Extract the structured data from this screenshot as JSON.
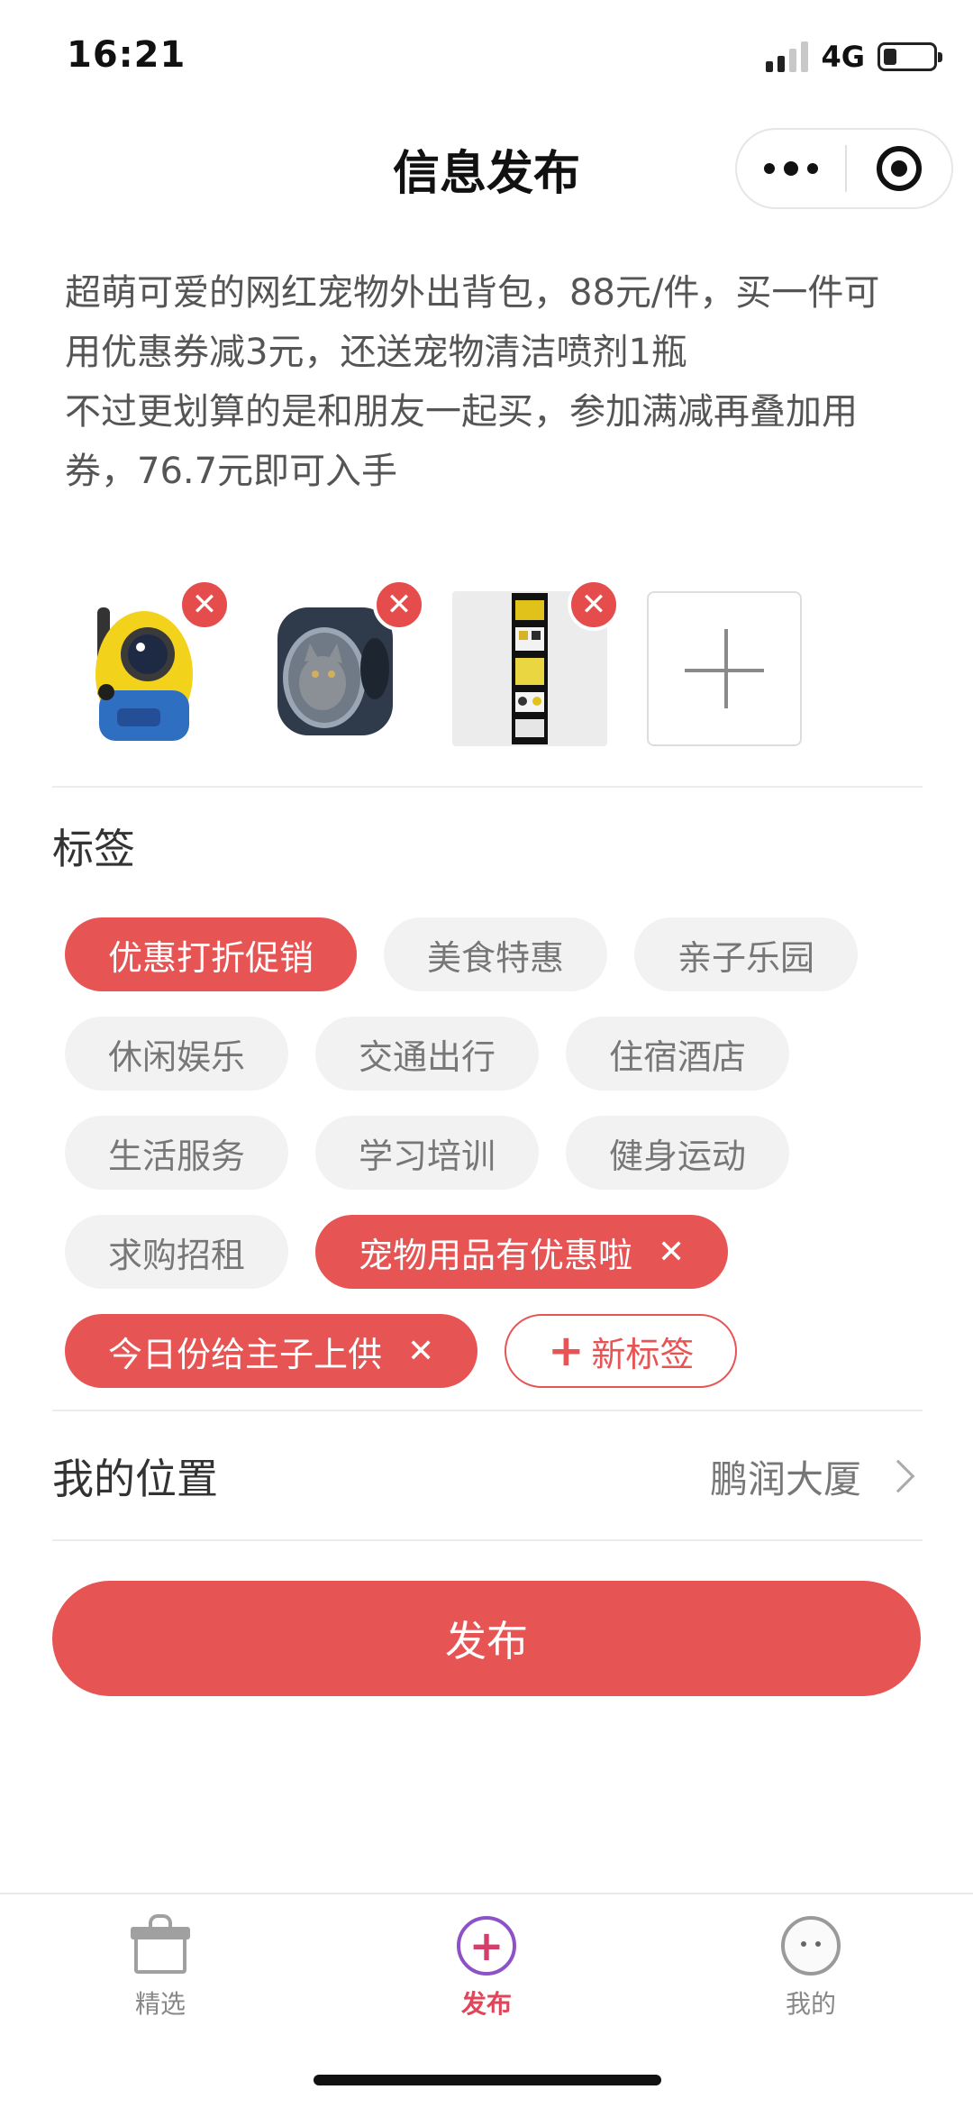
{
  "status_bar": {
    "time": "16:21",
    "network": "4G",
    "battery_percent": 20
  },
  "nav": {
    "title": "信息发布"
  },
  "post": {
    "description": "超萌可爱的网红宠物外出背包，88元/件，买一件可用优惠券减3元，还送宠物清洁喷剂1瓶\n不过更划算的是和朋友一起买，参加满减再叠加用券，76.7元即可入手"
  },
  "images": [
    {
      "kind": "yellow-backpack"
    },
    {
      "kind": "clear-backpack"
    },
    {
      "kind": "detail-strip"
    }
  ],
  "tags": {
    "title": "标签",
    "items": [
      {
        "label": "优惠打折促销",
        "active": true,
        "removable": false
      },
      {
        "label": "美食特惠",
        "active": false,
        "removable": false
      },
      {
        "label": "亲子乐园",
        "active": false,
        "removable": false
      },
      {
        "label": "休闲娱乐",
        "active": false,
        "removable": false
      },
      {
        "label": "交通出行",
        "active": false,
        "removable": false
      },
      {
        "label": "住宿酒店",
        "active": false,
        "removable": false
      },
      {
        "label": "生活服务",
        "active": false,
        "removable": false
      },
      {
        "label": "学习培训",
        "active": false,
        "removable": false
      },
      {
        "label": "健身运动",
        "active": false,
        "removable": false
      },
      {
        "label": "求购招租",
        "active": false,
        "removable": false
      },
      {
        "label": "宠物用品有优惠啦",
        "active": true,
        "removable": true
      },
      {
        "label": "今日份给主子上供",
        "active": true,
        "removable": true
      }
    ],
    "new_tag_label": "新标签"
  },
  "location": {
    "label": "我的位置",
    "value": "鹏润大厦"
  },
  "publish_label": "发布",
  "tab_bar": {
    "items": [
      {
        "label": "精选",
        "icon": "gift-icon",
        "active": false
      },
      {
        "label": "发布",
        "icon": "plus-circle-icon",
        "active": true
      },
      {
        "label": "我的",
        "icon": "face-icon",
        "active": false
      }
    ]
  },
  "colors": {
    "accent": "#e65454",
    "tab_active": "#e0455a",
    "tag_bg": "#f2f2f2"
  }
}
